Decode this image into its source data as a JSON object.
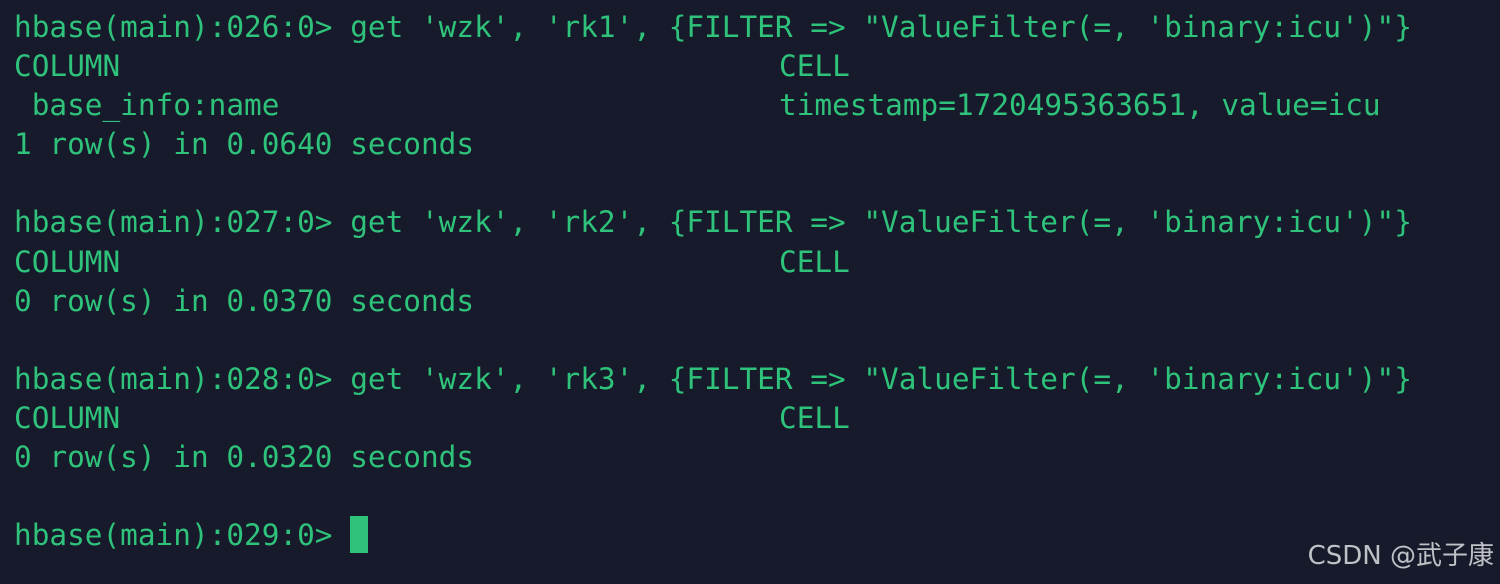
{
  "terminal": {
    "blocks": [
      {
        "prompt": "hbase(main):026:0> ",
        "command": "get 'wzk', 'rk1', {FILTER => \"ValueFilter(=, 'binary:icu')\"}",
        "header": {
          "column": "COLUMN",
          "cell": "CELL"
        },
        "rows": [
          {
            "column": " base_info:name",
            "cell": "timestamp=1720495363651, value=icu"
          }
        ],
        "summary": "1 row(s) in 0.0640 seconds"
      },
      {
        "prompt": "hbase(main):027:0> ",
        "command": "get 'wzk', 'rk2', {FILTER => \"ValueFilter(=, 'binary:icu')\"}",
        "header": {
          "column": "COLUMN",
          "cell": "CELL"
        },
        "summary": "0 row(s) in 0.0370 seconds"
      },
      {
        "prompt": "hbase(main):028:0> ",
        "command": "get 'wzk', 'rk3', {FILTER => \"ValueFilter(=, 'binary:icu')\"}",
        "header": {
          "column": "COLUMN",
          "cell": "CELL"
        },
        "summary": "0 row(s) in 0.0320 seconds"
      }
    ],
    "current_prompt": "hbase(main):029:0> ",
    "text_color": "#2fc27a",
    "background": "#161a2b"
  },
  "watermark": "CSDN @武子康"
}
